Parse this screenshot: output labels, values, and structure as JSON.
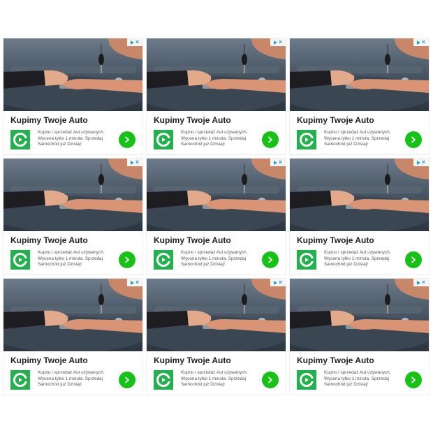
{
  "ad": {
    "title": "Kupimy Twoje Auto",
    "description_lines": [
      "Kupno i sprzedaż Aut używanych.",
      "Wycena tylko 1 minuta. Sprzedaj",
      "Samochód już Dzisiaj!"
    ],
    "adchoices_icon": "adchoices-triangle-icon",
    "close_icon": "close-x-icon",
    "logo_icon": "green-c-arrow-logo-icon",
    "cta_icon": "chevron-right-icon"
  },
  "colors": {
    "brand_green": "#22b14c",
    "cta_green": "#16c216",
    "adchoices_blue": "#1aa3d6"
  },
  "ads": [
    {
      "id": "ad-1"
    },
    {
      "id": "ad-2"
    },
    {
      "id": "ad-3"
    },
    {
      "id": "ad-4"
    },
    {
      "id": "ad-5"
    },
    {
      "id": "ad-6"
    },
    {
      "id": "ad-7"
    },
    {
      "id": "ad-8"
    },
    {
      "id": "ad-9"
    }
  ]
}
